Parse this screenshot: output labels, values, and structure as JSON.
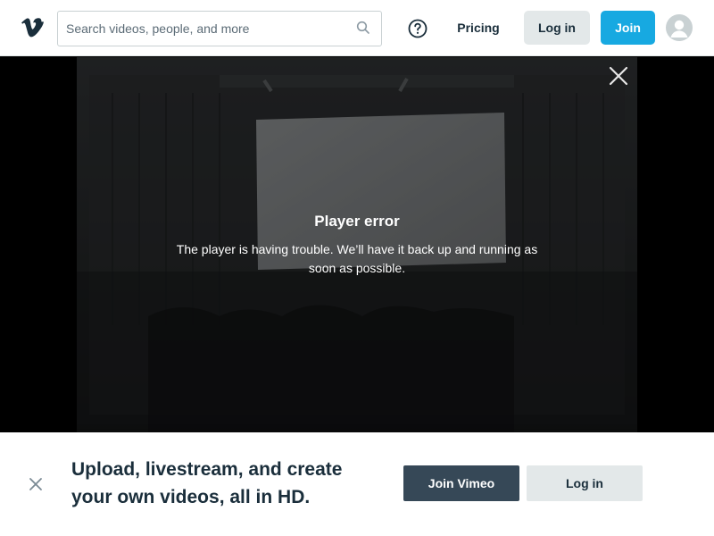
{
  "header": {
    "logo_icon": "vimeo-v-logo",
    "search": {
      "placeholder": "Search videos, people, and more",
      "value": ""
    },
    "help_icon": "question-circle-icon",
    "pricing_label": "Pricing",
    "login_label": "Log in",
    "join_label": "Join",
    "brand_color": "#17a9e1"
  },
  "player": {
    "close_icon": "close-icon",
    "error_title": "Player error",
    "error_message": "The player is having trouble. We’ll have it back up and running as soon as possible."
  },
  "banner": {
    "close_icon": "close-icon",
    "headline": "Upload, livestream, and create your own videos, all in HD.",
    "join_label": "Join Vimeo",
    "login_label": "Log in"
  }
}
